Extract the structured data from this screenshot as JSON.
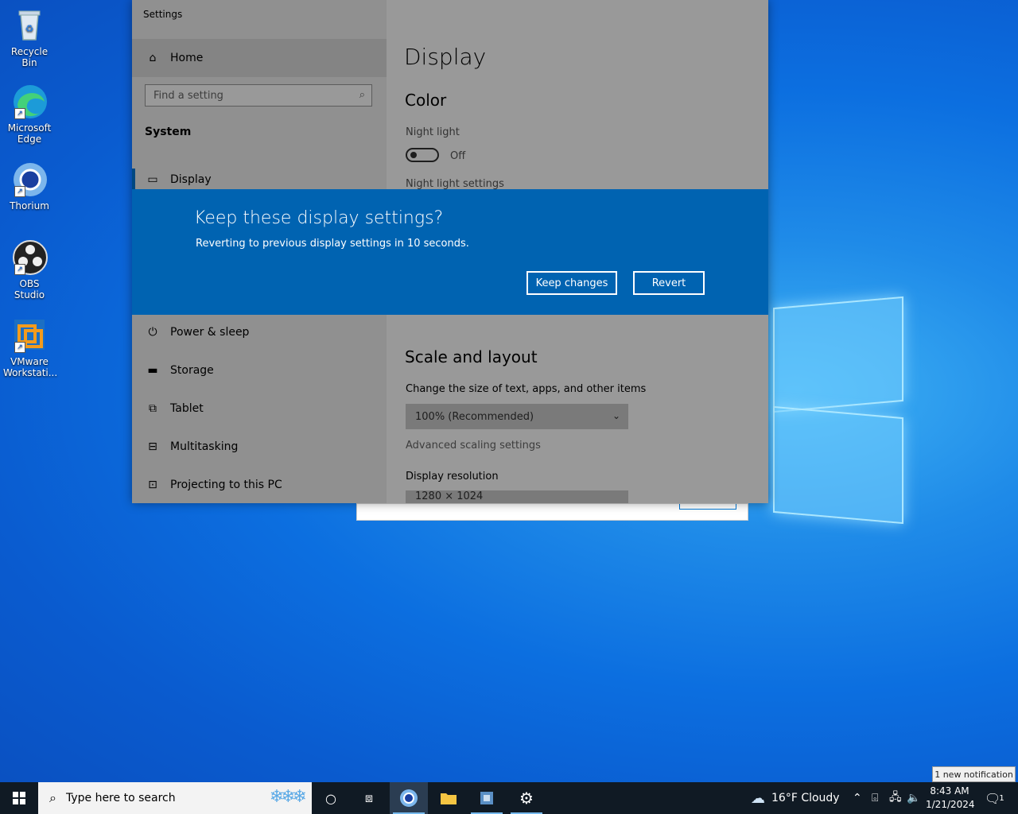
{
  "desktop": {
    "icons": [
      {
        "label_line1": "Recycle Bin",
        "label_line2": ""
      },
      {
        "label_line1": "Microsoft",
        "label_line2": "Edge"
      },
      {
        "label_line1": "Thorium",
        "label_line2": ""
      },
      {
        "label_line1": "OBS Studio",
        "label_line2": ""
      },
      {
        "label_line1": "VMware",
        "label_line2": "Workstati..."
      }
    ]
  },
  "settings": {
    "title": "Settings",
    "nav": {
      "home": "Home",
      "search_placeholder": "Find a setting",
      "section": "System",
      "items": [
        "Display",
        "Power & sleep",
        "Storage",
        "Tablet",
        "Multitasking",
        "Projecting to this PC"
      ]
    },
    "main": {
      "page_title": "Display",
      "color_heading": "Color",
      "night_light_label": "Night light",
      "night_light_state": "Off",
      "night_light_settings": "Night light settings",
      "scale_heading": "Scale and layout",
      "scale_label": "Change the size of text, apps, and other items",
      "scale_value": "100% (Recommended)",
      "advanced_scaling": "Advanced scaling settings",
      "resolution_label": "Display resolution",
      "resolution_value": "1280 × 1024"
    }
  },
  "dialog": {
    "heading": "Keep these display settings?",
    "message": "Reverting to previous display settings in 10 seconds.",
    "keep_label": "Keep changes",
    "revert_label": "Revert",
    "color": "#0063b1"
  },
  "taskbar": {
    "search_placeholder": "Type here to search",
    "weather": "16°F  Cloudy",
    "time": "8:43 AM",
    "date": "1/21/2024",
    "notification_count": "1",
    "toast": "1 new notification"
  }
}
